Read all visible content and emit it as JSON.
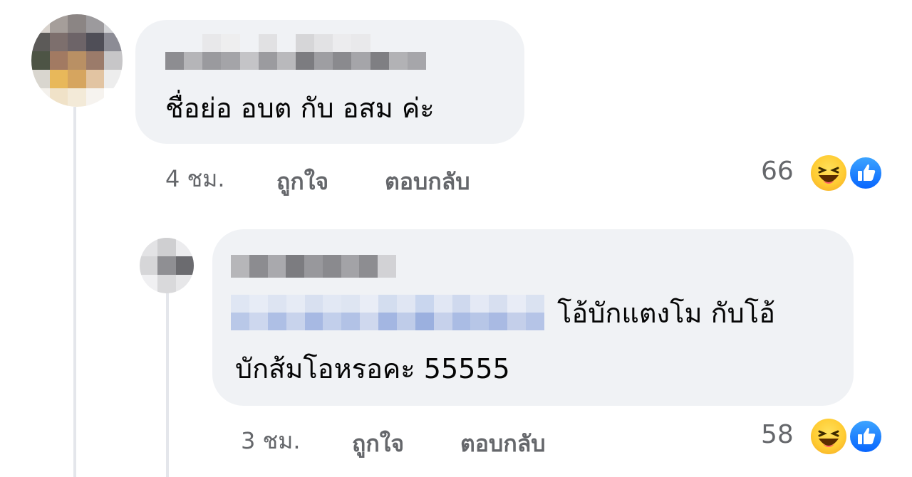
{
  "comments": [
    {
      "text": "ชื่อย่อ อบต กับ อสม ค่ะ",
      "time": "4 ชม.",
      "like_label": "ถูกใจ",
      "reply_label": "ตอบกลับ",
      "reaction_count": "66",
      "reactions": [
        "haha-icon",
        "like-icon"
      ]
    },
    {
      "text_line1": "โอ้บักแตงโม กับโอ้",
      "text_line2": "บักส้มโอหรอคะ 55555",
      "time": "3 ชม.",
      "like_label": "ถูกใจ",
      "reply_label": "ตอบกลับ",
      "reaction_count": "58",
      "reactions": [
        "haha-icon",
        "like-icon"
      ]
    }
  ],
  "colors": {
    "bubble": "#f0f2f5",
    "meta_text": "#65676b",
    "like_blue": "#0865fe",
    "haha_yellow": "#ffcc33"
  }
}
